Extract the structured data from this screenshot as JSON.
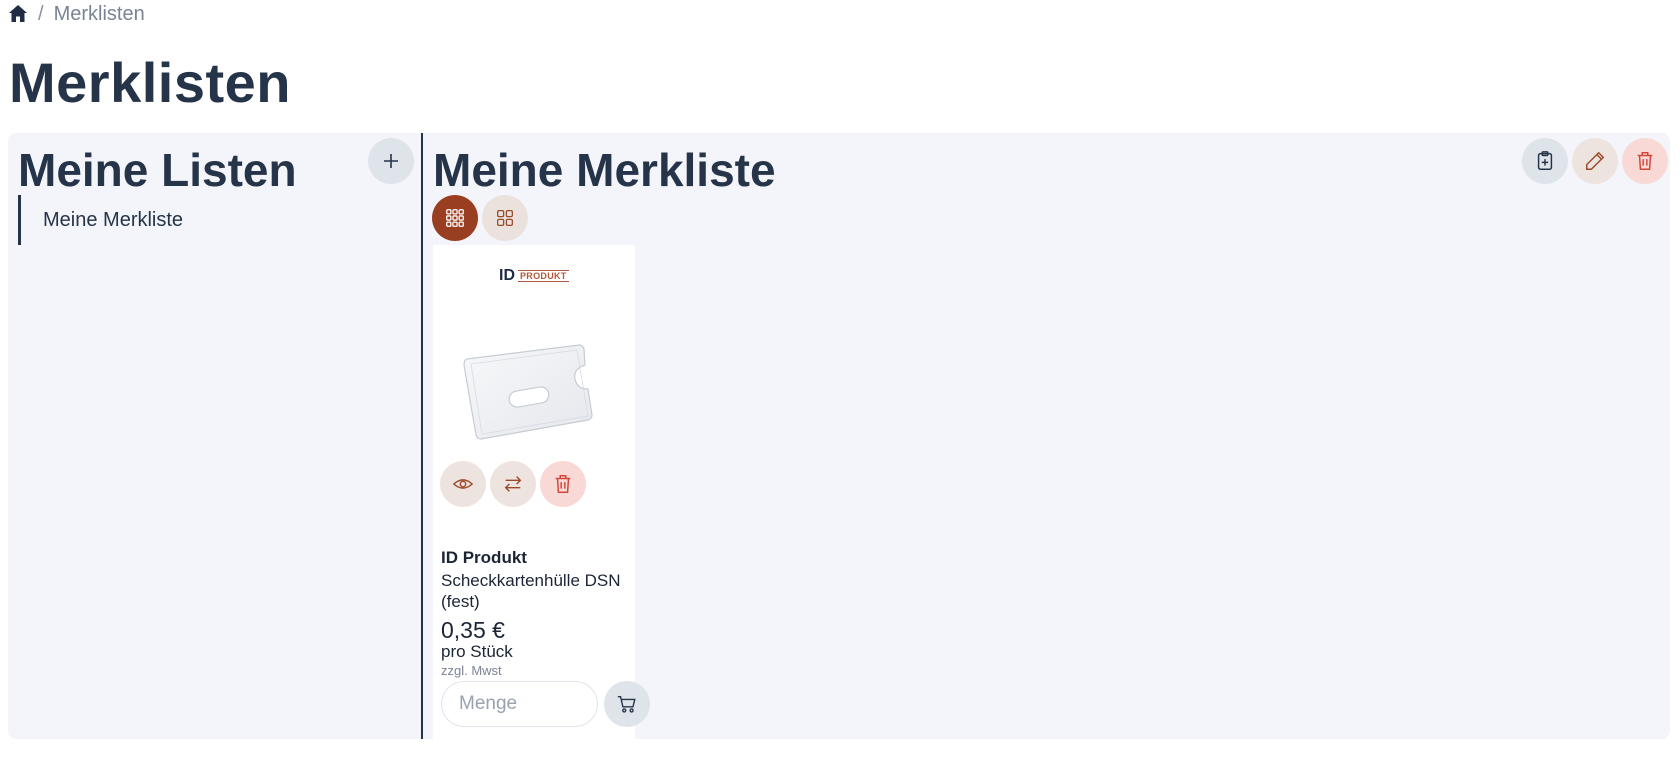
{
  "breadcrumb": {
    "home_icon": "home-icon",
    "separator": "/",
    "current": "Merklisten"
  },
  "page": {
    "title": "Merklisten"
  },
  "sidebar": {
    "title": "Meine Listen",
    "add_icon": "plus-icon",
    "items": [
      {
        "label": "Meine Merkliste",
        "active": true
      }
    ]
  },
  "main": {
    "title": "Meine Merkliste",
    "actions": [
      {
        "icon": "clipboard-plus-icon",
        "color": "#263449"
      },
      {
        "icon": "pencil-icon",
        "color": "#9a4a2a"
      },
      {
        "icon": "trash-icon",
        "color": "#d1473c"
      }
    ],
    "views": [
      {
        "icon": "grid-small-icon",
        "active": true
      },
      {
        "icon": "grid-large-icon",
        "active": false
      }
    ]
  },
  "product": {
    "logo": {
      "part1": "ID",
      "part2": "PRODUKT"
    },
    "brand": "ID Produkt",
    "name": "Scheckkartenhülle DSN (fest)",
    "price": "0,35 €",
    "unit": "pro Stück",
    "tax_note": "zzgl. Mwst",
    "actions": [
      "eye-icon",
      "swap-arrows-icon",
      "trash-icon"
    ],
    "quantity": {
      "placeholder": "Menge",
      "value": ""
    },
    "cart_icon": "cart-icon"
  },
  "colors": {
    "primary": "#263449",
    "accent": "#9a3e22",
    "danger": "#d1473c",
    "panel_bg": "#f3f5fa"
  }
}
